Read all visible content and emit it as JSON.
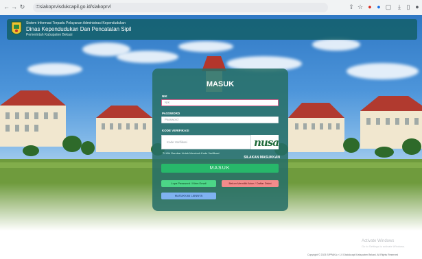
{
  "browser": {
    "back_icon": "back-arrow-icon",
    "forward_icon": "forward-arrow-icon",
    "reload_icon": "reload-icon",
    "url": "siakoprvisdukcapil.go.id/siakoprv/"
  },
  "header": {
    "line1": "Sistem Informasi Terpadu Pelayanan Administrasi Kependudukan",
    "line2": "Dinas Kependudukan Dan Pencatatan Sipil",
    "line3": "Pemerintah Kabupaten Bekasi"
  },
  "login": {
    "title": "MASUK",
    "nik_label": "NIK",
    "nik_placeholder": "NIK",
    "password_label": "PASSWORD",
    "password_placeholder": "Password",
    "captcha_label": "KODE VERIFIKASI",
    "captcha_placeholder": "Kode Verifikasi",
    "captcha_text": "nusa",
    "captcha_hint": "Klik Gambar Untuk Merubah Kode Verifikasi",
    "note": "SILAKAN MASUKKAN",
    "submit_label": "MASUK",
    "forgot_label": "Lupa Password / Kirim Email",
    "register_label": "Belum Memiliki Akun / Daftar Disini",
    "other_label": "MASUKKAN LAINNYA"
  },
  "windows": {
    "activate_title": "Activate Windows",
    "activate_sub": "Go to Settings to activate Windows."
  },
  "footer": {
    "copyright": "Copyright © 2023 SIPPAKA v 1.0 Disdukcapil Kabupaten Bekasi. All Rights Reserved"
  },
  "colors": {
    "header_bg": "#135f69",
    "card_bg": "#287068",
    "submit": "#27b86a",
    "green_button": "#4cd687",
    "red_button": "#f28b8b",
    "blue_button": "#7fb2f0"
  }
}
